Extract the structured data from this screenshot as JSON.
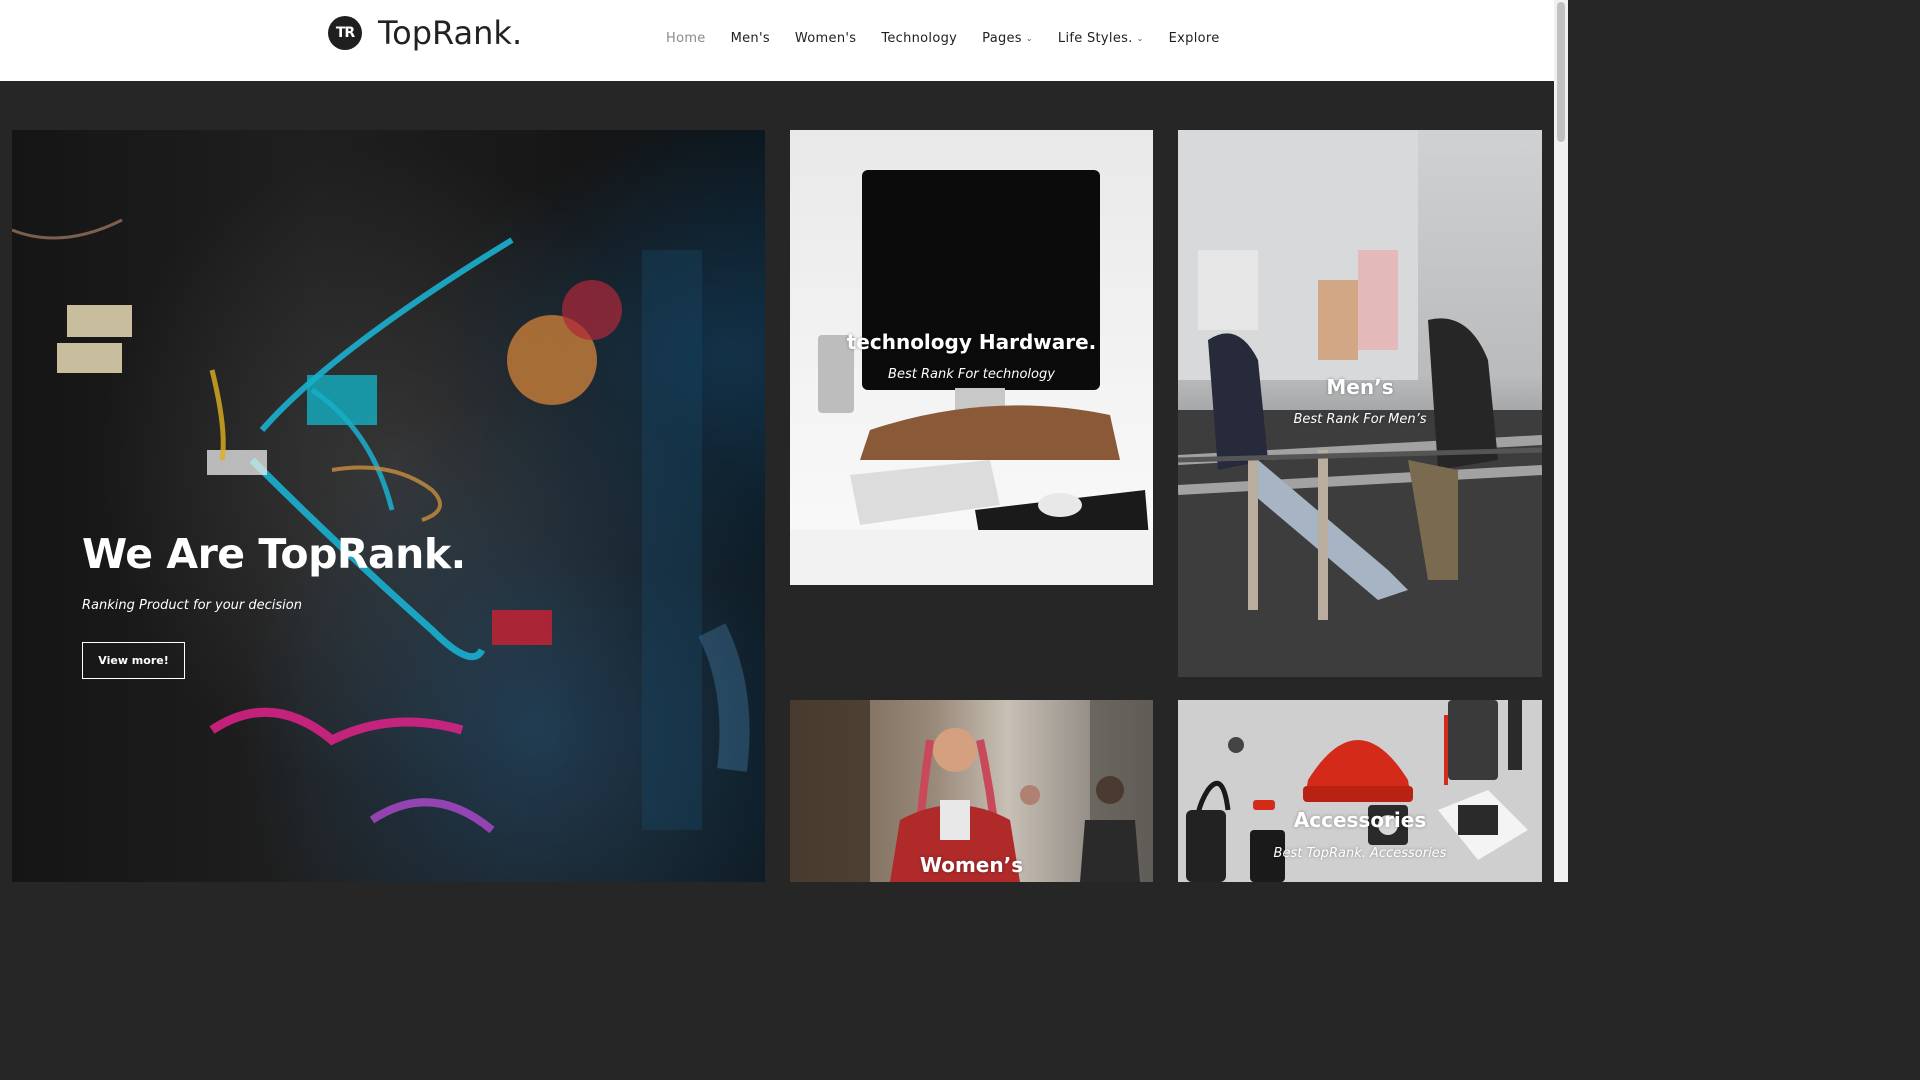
{
  "brand": {
    "logo_mark": "TR",
    "name": "TopRank."
  },
  "nav": {
    "items": [
      {
        "label": "Home",
        "active": true,
        "dropdown": false
      },
      {
        "label": "Men's",
        "active": false,
        "dropdown": false
      },
      {
        "label": "Women's",
        "active": false,
        "dropdown": false
      },
      {
        "label": "Technology",
        "active": false,
        "dropdown": false
      },
      {
        "label": "Pages",
        "active": false,
        "dropdown": true
      },
      {
        "label": "Life Styles.",
        "active": false,
        "dropdown": true
      },
      {
        "label": "Explore",
        "active": false,
        "dropdown": false
      }
    ],
    "caret": "⌄"
  },
  "hero": {
    "title": "We Are TopRank.",
    "subtitle": "Ranking Product for your decision",
    "button": "View more!"
  },
  "tiles": {
    "technology": {
      "title": "technology Hardware.",
      "subtitle": "Best Rank For technology"
    },
    "mens": {
      "title": "Men’s",
      "subtitle": "Best Rank For Men’s"
    },
    "womens": {
      "title": "Women’s"
    },
    "accessories": {
      "title": "Accessories",
      "subtitle": "Best TopRank. Accessories"
    }
  },
  "colors": {
    "page_bg": "#262626",
    "header_bg": "#ffffff",
    "nav_active": "#8a8a8a",
    "nav_text": "#222222"
  },
  "icons": {
    "logo": "tr-logo-icon",
    "dropdown": "chevron-down-icon"
  }
}
